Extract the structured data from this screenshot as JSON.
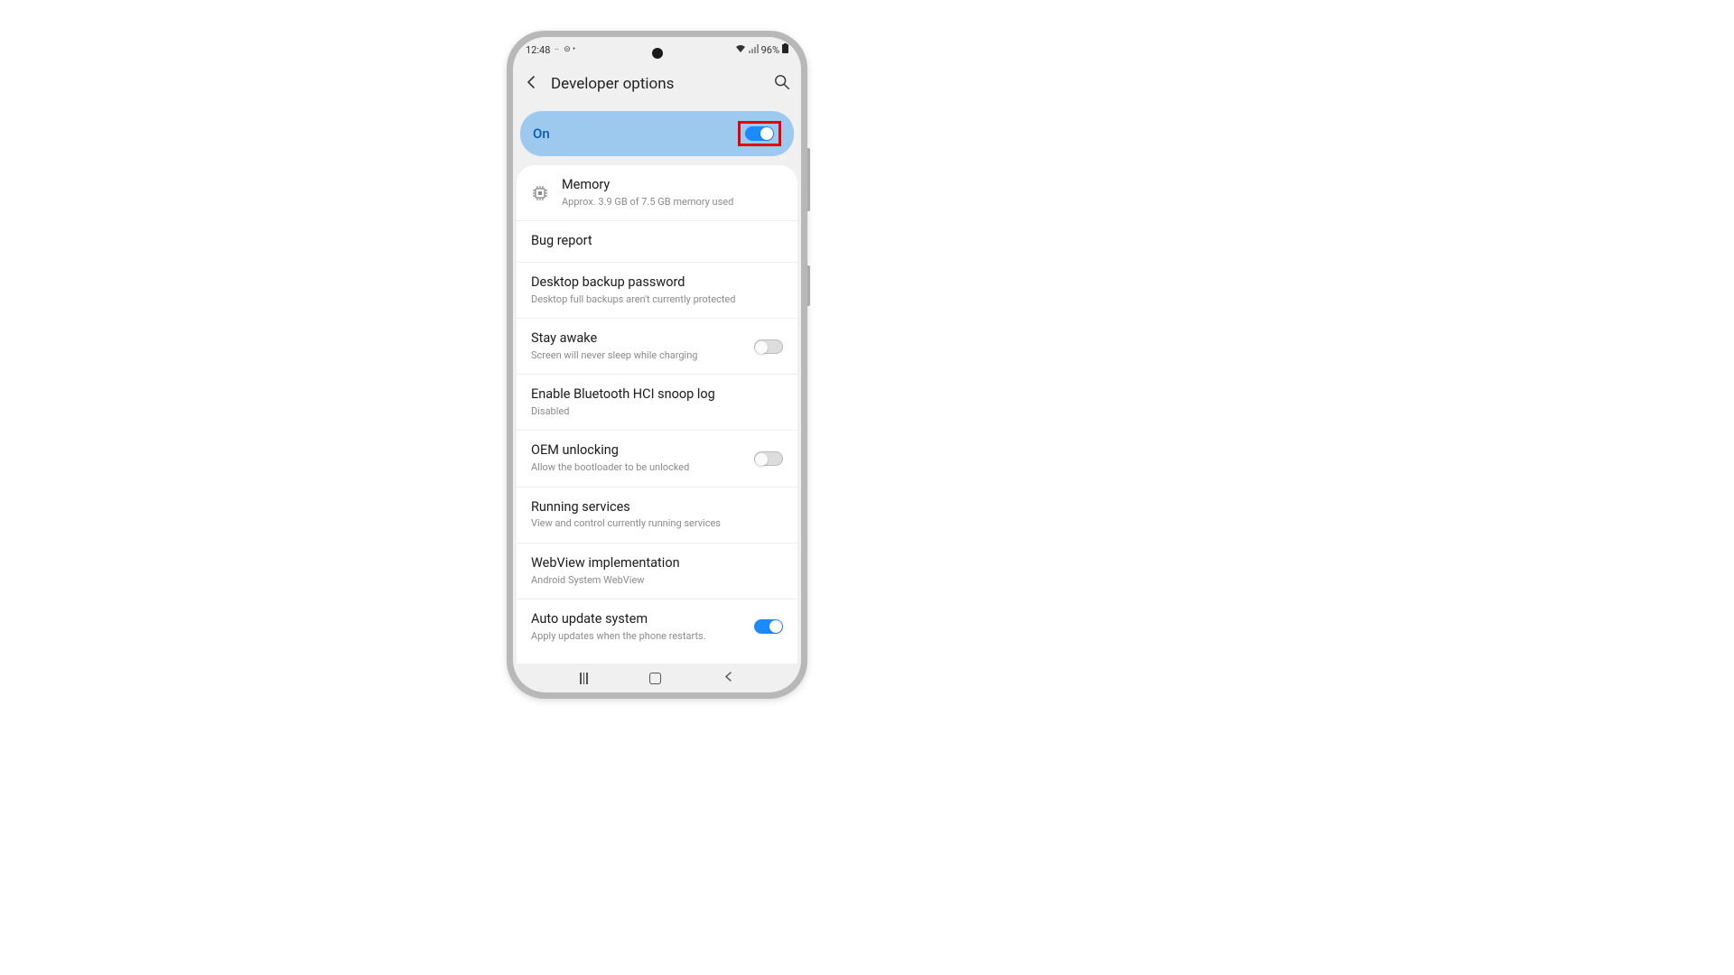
{
  "status": {
    "time": "12:48",
    "battery": "96%"
  },
  "header": {
    "title": "Developer options"
  },
  "master": {
    "label": "On",
    "state": "on"
  },
  "rows": [
    {
      "title": "Memory",
      "sub": "Approx. 3.9 GB of 7.5 GB memory used",
      "icon": true
    },
    {
      "title": "Bug report"
    },
    {
      "title": "Desktop backup password",
      "sub": "Desktop full backups aren't currently protected"
    },
    {
      "title": "Stay awake",
      "sub": "Screen will never sleep while charging",
      "toggle": "off"
    },
    {
      "title": "Enable Bluetooth HCI snoop log",
      "sub": "Disabled"
    },
    {
      "title": "OEM unlocking",
      "sub": "Allow the bootloader to be unlocked",
      "toggle": "off"
    },
    {
      "title": "Running services",
      "sub": "View and control currently running services"
    },
    {
      "title": "WebView implementation",
      "sub": "Android System WebView"
    },
    {
      "title": "Auto update system",
      "sub": "Apply updates when the phone restarts.",
      "toggle": "on"
    }
  ]
}
